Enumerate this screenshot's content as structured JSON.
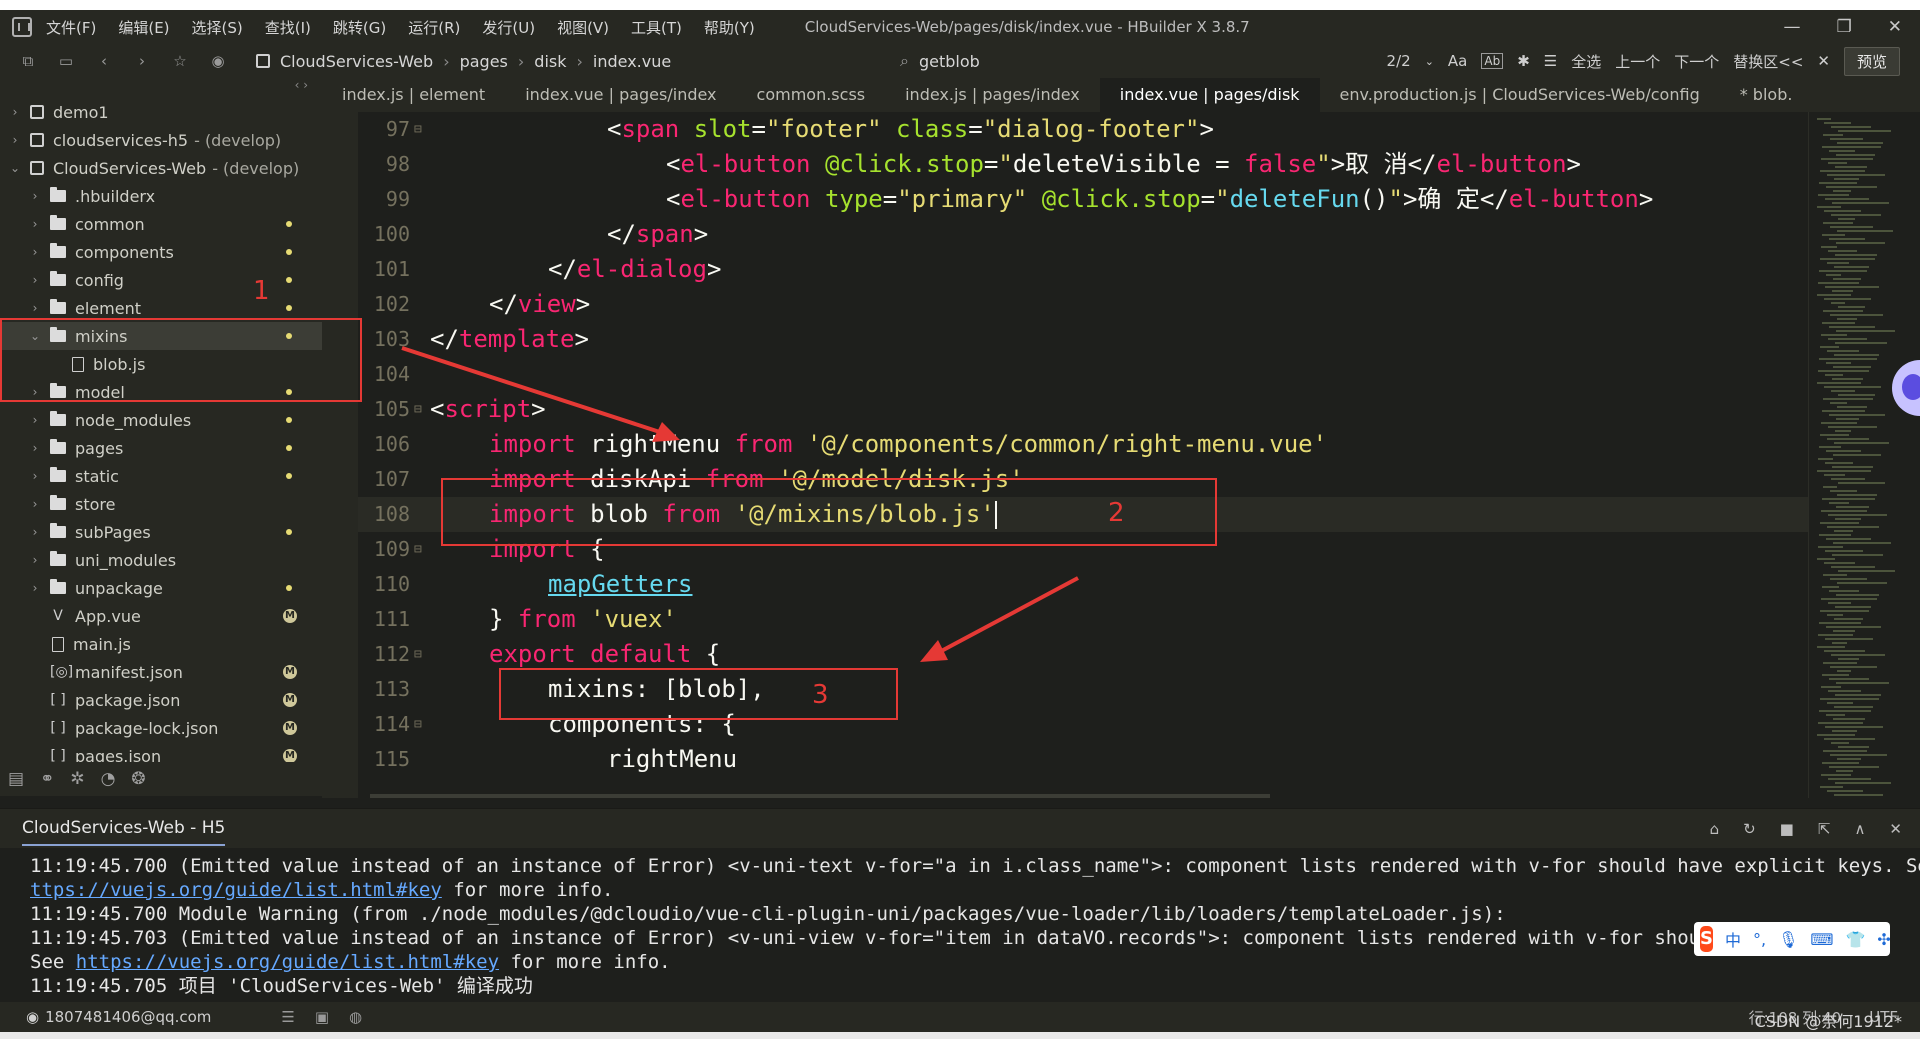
{
  "titlebar": {
    "menu": [
      "文件(F)",
      "编辑(E)",
      "选择(S)",
      "查找(I)",
      "跳转(G)",
      "运行(R)",
      "发行(U)",
      "视图(V)",
      "工具(T)",
      "帮助(Y)"
    ],
    "window_title": "CloudServices-Web/pages/disk/index.vue - HBuilder X 3.8.7"
  },
  "toolbar": {
    "breadcrumbs": [
      "CloudServices-Web",
      "pages",
      "disk",
      "index.vue"
    ],
    "search_text": "getblob",
    "match_count": "2/2",
    "case_label": "Aa",
    "word_label": "Ab",
    "select_all": "全选",
    "prev": "上一个",
    "next": "下一个",
    "replace": "替换区<<",
    "preview": "预览"
  },
  "sidebar": {
    "items": [
      {
        "label": "demo1",
        "branch": "",
        "kind": "project",
        "level": 0,
        "expanded": false
      },
      {
        "label": "cloudservices-h5",
        "branch": "- (develop)",
        "kind": "project",
        "level": 0,
        "expanded": false
      },
      {
        "label": "CloudServices-Web",
        "branch": "- (develop)",
        "kind": "project",
        "level": 0,
        "expanded": true
      },
      {
        "label": ".hbuilderx",
        "kind": "folder",
        "level": 1,
        "badge": ""
      },
      {
        "label": "common",
        "kind": "folder",
        "level": 1,
        "badge": "dot"
      },
      {
        "label": "components",
        "kind": "folder",
        "level": 1,
        "badge": "dot"
      },
      {
        "label": "config",
        "kind": "folder",
        "level": 1,
        "badge": "dot"
      },
      {
        "label": "element",
        "kind": "folder",
        "level": 1,
        "badge": "dot"
      },
      {
        "label": "mixins",
        "kind": "folder",
        "level": 1,
        "badge": "dot",
        "expanded": true
      },
      {
        "label": "blob.js",
        "kind": "file",
        "level": 2,
        "badge": ""
      },
      {
        "label": "model",
        "kind": "folder",
        "level": 1,
        "badge": "dot"
      },
      {
        "label": "node_modules",
        "kind": "folder",
        "level": 1,
        "badge": "dot"
      },
      {
        "label": "pages",
        "kind": "folder",
        "level": 1,
        "badge": "dot"
      },
      {
        "label": "static",
        "kind": "folder",
        "level": 1,
        "badge": "dot"
      },
      {
        "label": "store",
        "kind": "folder",
        "level": 1,
        "badge": ""
      },
      {
        "label": "subPages",
        "kind": "folder",
        "level": 1,
        "badge": "dot"
      },
      {
        "label": "uni_modules",
        "kind": "folder",
        "level": 1,
        "badge": ""
      },
      {
        "label": "unpackage",
        "kind": "folder",
        "level": 1,
        "badge": "dot"
      },
      {
        "label": "App.vue",
        "kind": "vue",
        "level": 1,
        "badge": "M"
      },
      {
        "label": "main.js",
        "kind": "file",
        "level": 1,
        "badge": ""
      },
      {
        "label": "manifest.json",
        "kind": "manifest",
        "level": 1,
        "badge": "M"
      },
      {
        "label": "package.json",
        "kind": "json",
        "level": 1,
        "badge": "M"
      },
      {
        "label": "package-lock.json",
        "kind": "json",
        "level": 1,
        "badge": "M"
      },
      {
        "label": "pages.json",
        "kind": "json",
        "level": 1,
        "badge": "M"
      }
    ]
  },
  "tabs": [
    {
      "label": "index.js | element",
      "active": false
    },
    {
      "label": "index.vue | pages/index",
      "active": false
    },
    {
      "label": "common.scss",
      "active": false
    },
    {
      "label": "index.js | pages/index",
      "active": false
    },
    {
      "label": "index.vue | pages/disk",
      "active": true
    },
    {
      "label": "env.production.js | CloudServices-Web/config",
      "active": false
    },
    {
      "label": "* blob.",
      "active": false
    }
  ],
  "editor": {
    "lines": [
      {
        "no": "97",
        "fold": true,
        "indent": 6,
        "tokens": [
          [
            "t-pl",
            "<"
          ],
          [
            "t-tag",
            "span"
          ],
          [
            "t-pl",
            " "
          ],
          [
            "t-attr",
            "slot"
          ],
          [
            "t-pl",
            "="
          ],
          [
            "t-str",
            "\"footer\""
          ],
          [
            "t-pl",
            " "
          ],
          [
            "t-attr",
            "class"
          ],
          [
            "t-pl",
            "="
          ],
          [
            "t-str",
            "\"dialog-footer\""
          ],
          [
            "t-pl",
            ">"
          ]
        ]
      },
      {
        "no": "98",
        "fold": false,
        "indent": 8,
        "tokens": [
          [
            "t-pl",
            "<"
          ],
          [
            "t-tag",
            "el-button"
          ],
          [
            "t-pl",
            " "
          ],
          [
            "t-attr",
            "@click.stop"
          ],
          [
            "t-pl",
            "="
          ],
          [
            "t-str",
            "\""
          ],
          [
            "t-pl",
            "deleteVisible = "
          ],
          [
            "t-kw",
            "false"
          ],
          [
            "t-str",
            "\""
          ],
          [
            "t-pl",
            ">取 消</"
          ],
          [
            "t-tag",
            "el-button"
          ],
          [
            "t-pl",
            ">"
          ]
        ]
      },
      {
        "no": "99",
        "fold": false,
        "indent": 8,
        "tokens": [
          [
            "t-pl",
            "<"
          ],
          [
            "t-tag",
            "el-button"
          ],
          [
            "t-pl",
            " "
          ],
          [
            "t-attr",
            "type"
          ],
          [
            "t-pl",
            "="
          ],
          [
            "t-str",
            "\"primary\""
          ],
          [
            "t-pl",
            " "
          ],
          [
            "t-attr",
            "@click.stop"
          ],
          [
            "t-pl",
            "="
          ],
          [
            "t-str",
            "\""
          ],
          [
            "t-fn",
            "deleteFun"
          ],
          [
            "t-pl",
            "()"
          ],
          [
            "t-str",
            "\""
          ],
          [
            "t-pl",
            ">确 定</"
          ],
          [
            "t-tag",
            "el-button"
          ],
          [
            "t-pl",
            ">"
          ]
        ]
      },
      {
        "no": "100",
        "fold": false,
        "indent": 6,
        "tokens": [
          [
            "t-pl",
            "</"
          ],
          [
            "t-tag",
            "span"
          ],
          [
            "t-pl",
            ">"
          ]
        ]
      },
      {
        "no": "101",
        "fold": false,
        "indent": 4,
        "tokens": [
          [
            "t-pl",
            "</"
          ],
          [
            "t-tag",
            "el-dialog"
          ],
          [
            "t-pl",
            ">"
          ]
        ]
      },
      {
        "no": "102",
        "fold": false,
        "indent": 2,
        "tokens": [
          [
            "t-pl",
            "</"
          ],
          [
            "t-tag",
            "view"
          ],
          [
            "t-pl",
            ">"
          ]
        ]
      },
      {
        "no": "103",
        "fold": false,
        "indent": 0,
        "tokens": [
          [
            "t-pl",
            "</"
          ],
          [
            "t-tag",
            "template"
          ],
          [
            "t-pl",
            ">"
          ]
        ]
      },
      {
        "no": "104",
        "fold": false,
        "indent": 0,
        "tokens": []
      },
      {
        "no": "105",
        "fold": true,
        "indent": 0,
        "tokens": [
          [
            "t-pl",
            "<"
          ],
          [
            "t-tag",
            "script"
          ],
          [
            "t-pl",
            ">"
          ]
        ]
      },
      {
        "no": "106",
        "fold": false,
        "indent": 2,
        "tokens": [
          [
            "t-kw",
            "import"
          ],
          [
            "t-pl",
            " rightMenu "
          ],
          [
            "t-kw",
            "from"
          ],
          [
            "t-pl",
            " "
          ],
          [
            "t-str",
            "'@/components/common/right-menu.vue'"
          ]
        ]
      },
      {
        "no": "107",
        "fold": false,
        "indent": 2,
        "tokens": [
          [
            "t-kw",
            "import"
          ],
          [
            "t-pl",
            " diskApi "
          ],
          [
            "t-kw",
            "from"
          ],
          [
            "t-pl",
            " "
          ],
          [
            "t-str",
            "'@/model/disk.js'"
          ]
        ]
      },
      {
        "no": "108",
        "fold": false,
        "indent": 2,
        "current": true,
        "tokens": [
          [
            "t-kw",
            "import"
          ],
          [
            "t-pl",
            " blob "
          ],
          [
            "t-kw",
            "from"
          ],
          [
            "t-pl",
            " "
          ],
          [
            "t-str",
            "'@/mixins/blob.js'"
          ]
        ]
      },
      {
        "no": "109",
        "fold": true,
        "indent": 2,
        "tokens": [
          [
            "t-kw",
            "import"
          ],
          [
            "t-pl",
            " {"
          ]
        ]
      },
      {
        "no": "110",
        "fold": false,
        "indent": 4,
        "tokens": [
          [
            "t-link",
            "mapGetters"
          ]
        ]
      },
      {
        "no": "111",
        "fold": false,
        "indent": 2,
        "tokens": [
          [
            "t-pl",
            "} "
          ],
          [
            "t-kw",
            "from"
          ],
          [
            "t-pl",
            " "
          ],
          [
            "t-str",
            "'vuex'"
          ]
        ]
      },
      {
        "no": "112",
        "fold": true,
        "indent": 2,
        "tokens": [
          [
            "t-kw",
            "export"
          ],
          [
            "t-pl",
            " "
          ],
          [
            "t-kw",
            "default"
          ],
          [
            "t-pl",
            " {"
          ]
        ]
      },
      {
        "no": "113",
        "fold": false,
        "indent": 4,
        "tokens": [
          [
            "t-pl",
            "mixins: [blob],"
          ]
        ]
      },
      {
        "no": "114",
        "fold": true,
        "indent": 4,
        "tokens": [
          [
            "t-pl",
            "components: {"
          ]
        ]
      },
      {
        "no": "115",
        "fold": false,
        "indent": 6,
        "tokens": [
          [
            "t-pl",
            "rightMenu"
          ]
        ]
      }
    ]
  },
  "annotations": {
    "n1": "1",
    "n2": "2",
    "n3": "3"
  },
  "console": {
    "tab": "CloudServices-Web - H5",
    "lines": [
      [
        [
          "",
          "11:19:45.700 (Emitted value instead of an instance of Error) <v-uni-text v-for=\"a in i.class_name\">: component lists rendered with v-for should have explicit keys. See "
        ],
        [
          "c-link",
          "h"
        ]
      ],
      [
        [
          "c-link",
          "ttps://vuejs.org/guide/list.html#key"
        ],
        [
          "",
          " for more info."
        ]
      ],
      [
        [
          "",
          "11:19:45.700 Module Warning (from ./node_modules/@dcloudio/vue-cli-plugin-uni/packages/vue-loader/lib/loaders/templateLoader.js):"
        ]
      ],
      [
        [
          "",
          "11:19:45.703 (Emitted value instead of an instance of Error) <v-uni-view v-for=\"item in dataVO.records\">: component lists rendered with v-for should hav"
        ]
      ],
      [
        [
          "",
          "See "
        ],
        [
          "c-link",
          "https://vuejs.org/guide/list.html#key"
        ],
        [
          "",
          " for more info."
        ]
      ],
      [
        [
          "",
          "11:19:45.705 项目 'CloudServices-Web' 编译成功"
        ]
      ]
    ]
  },
  "ime": {
    "logo": "S",
    "mode": "中",
    "punct": "°,"
  },
  "status": {
    "user": "1807481406@qq.com",
    "position": "行:108  列:40",
    "encoding": "UTF",
    "watermark": "CSDN @奈何1912*"
  }
}
